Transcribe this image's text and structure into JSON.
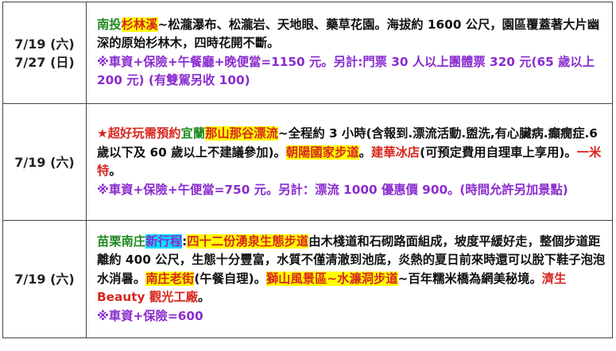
{
  "rows": [
    {
      "dates": [
        "7/19 (六)",
        "7/27 (日)"
      ],
      "segments": [
        {
          "text": "南投",
          "cls": "green"
        },
        {
          "text": "杉林溪",
          "cls": "red hl-yellow"
        },
        {
          "text": "~松瀧瀑布、松瀧岩、天地眼、藥草花園。海拔約 1600 公尺，園區覆蓋著大片幽深的原始杉林木，四時花開不斷。",
          "cls": "blk"
        },
        {
          "text": "",
          "cls": "br"
        },
        {
          "text": "※車資+保險+午餐廳+晚便當=1150 元。另計:門票 30 人以上團體票 320 元(65 歲以上 200 元) (有雙駕另收 100)",
          "cls": "purple"
        }
      ]
    },
    {
      "dates": [
        "7/19 (六)"
      ],
      "segments": [
        {
          "text": "★超好玩需預約",
          "cls": "red"
        },
        {
          "text": "宜蘭",
          "cls": "green"
        },
        {
          "text": "那山那谷漂流",
          "cls": "red hl-yellow"
        },
        {
          "text": "~全程約 3 小時(含報到.漂流活動.盥洗,有心臟病.癲癇症.6 歲以下及 60 歲以上不建議參加)。",
          "cls": "blk"
        },
        {
          "text": "朝陽國家步道",
          "cls": "red hl-yellow"
        },
        {
          "text": "。",
          "cls": "blk"
        },
        {
          "text": "建華冰店",
          "cls": "red"
        },
        {
          "text": "(可預定費用自理車上享用)。",
          "cls": "blk"
        },
        {
          "text": "一米特",
          "cls": "red"
        },
        {
          "text": "。",
          "cls": "blk"
        },
        {
          "text": "",
          "cls": "br"
        },
        {
          "text": "※車資+保險+午便當=750 元。另計：漂流 1000 優惠價 900。(時間允許另加景點)",
          "cls": "purple"
        }
      ]
    },
    {
      "dates": [
        "7/19 (六)"
      ],
      "segments": [
        {
          "text": "苗栗南庄",
          "cls": "green"
        },
        {
          "text": "新行程",
          "cls": "purple hl-cyan"
        },
        {
          "text": ":",
          "cls": "blk"
        },
        {
          "text": "四十二份湧泉生態步道",
          "cls": "red hl-yellow"
        },
        {
          "text": "由木棧道和石砌路面組成，坡度平緩好走，整個步道距離約 400 公尺，生態十分豐富，水質不僅清澈到池底，炎熱的夏日前來時還可以脫下鞋子泡泡水消暑。",
          "cls": "blk"
        },
        {
          "text": "南庄老街",
          "cls": "red hl-yellow"
        },
        {
          "text": "(午餐自理)。",
          "cls": "blk"
        },
        {
          "text": "獅山風景區~水濂洞步道",
          "cls": "red hl-yellow"
        },
        {
          "text": "~百年糯米橋為網美秘境。",
          "cls": "blk"
        },
        {
          "text": "濟生 Beauty 觀光工廠",
          "cls": "red"
        },
        {
          "text": "。",
          "cls": "blk"
        },
        {
          "text": "",
          "cls": "br"
        },
        {
          "text": "※車資+保險=600",
          "cls": "purple"
        }
      ]
    }
  ]
}
